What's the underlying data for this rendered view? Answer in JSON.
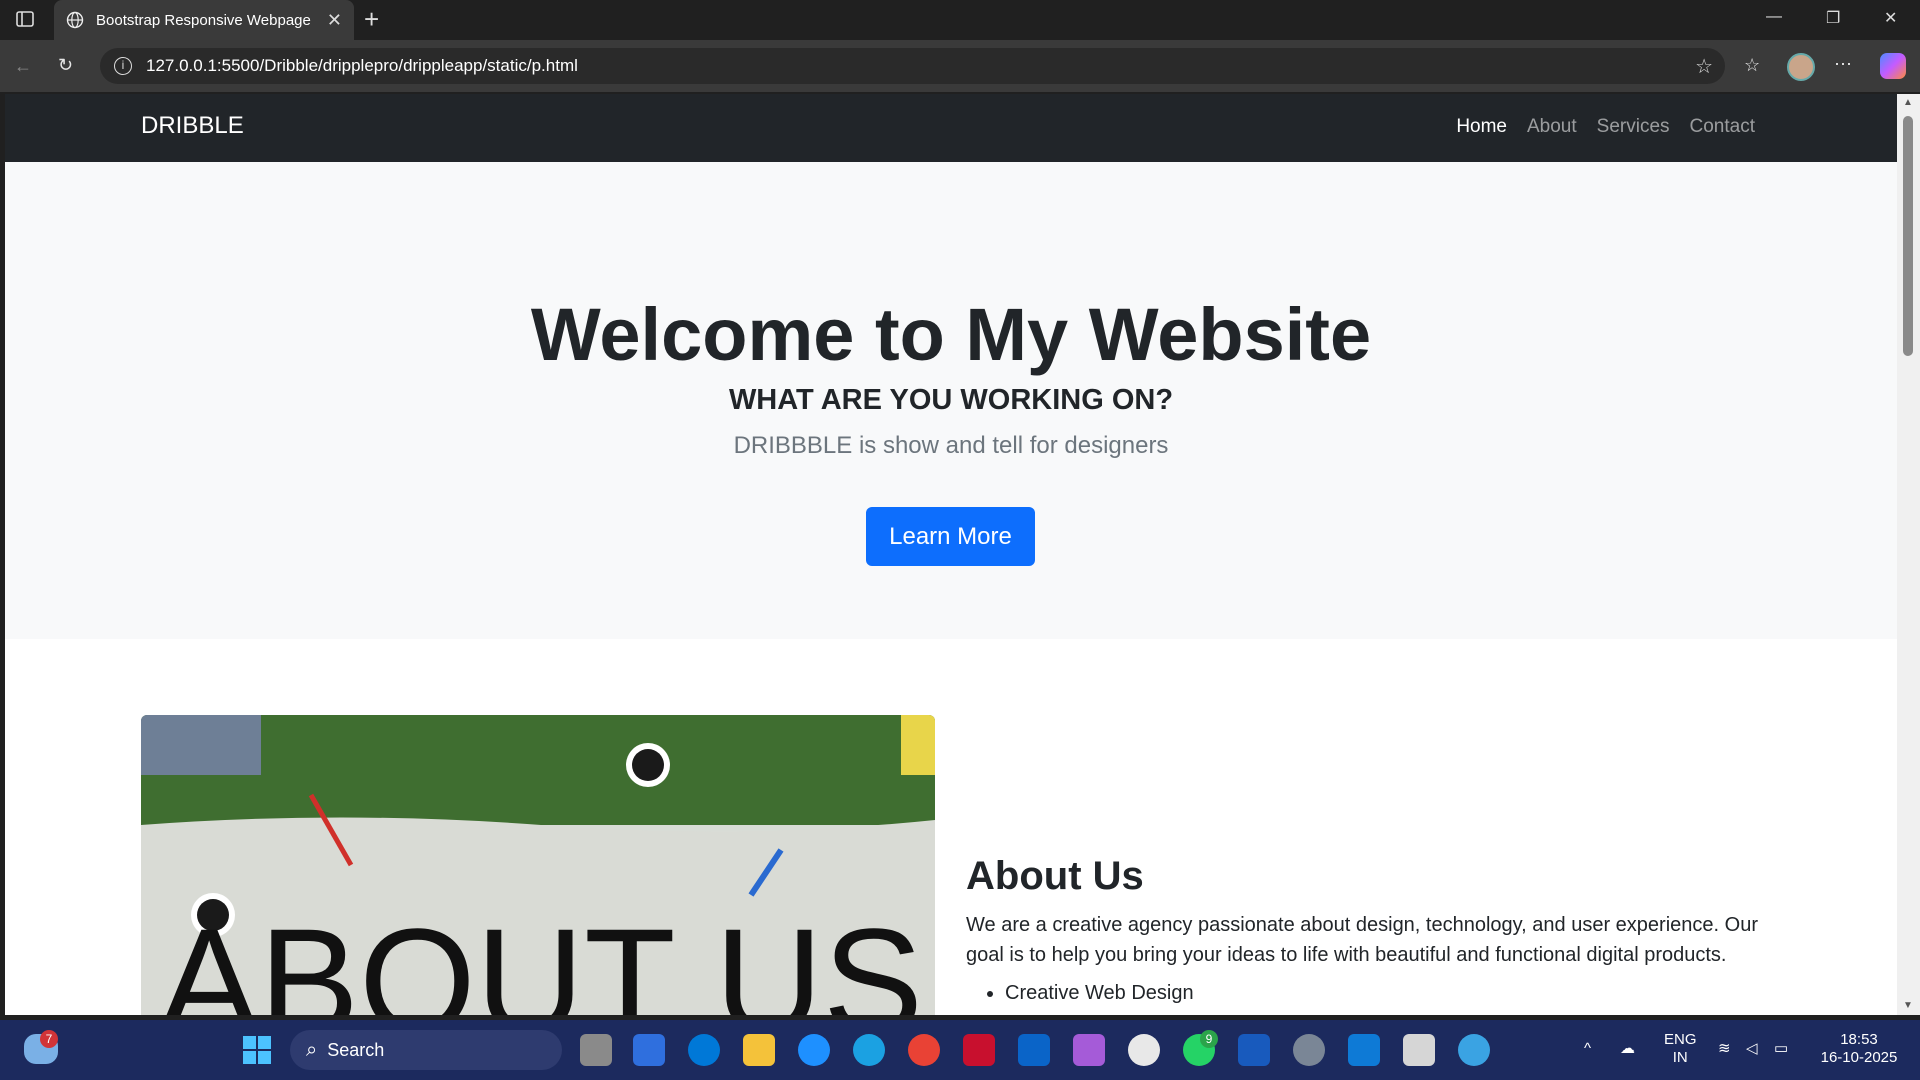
{
  "browser": {
    "tab_title": "Bootstrap Responsive Webpage",
    "address": "127.0.0.1:5500/Dribble/dripplepro/drippleapp/static/p.html"
  },
  "site": {
    "brand": "DRIBBLE",
    "nav": [
      "Home",
      "About",
      "Services",
      "Contact"
    ],
    "active_nav": "Home"
  },
  "hero": {
    "title": "Welcome to My Website",
    "subtitle": "WHAT ARE YOU WORKING ON?",
    "lead": "DRIBBBLE is show and tell for designers",
    "button": "Learn More"
  },
  "about": {
    "image_text": "ABOUT US",
    "heading": "About Us",
    "text": "We are a creative agency passionate about design, technology, and user experience. Our goal is to help you bring your ideas to life with beautiful and functional digital products.",
    "list": [
      "Creative Web Design"
    ]
  },
  "taskbar": {
    "search": "Search",
    "weather_badge": "7",
    "whatsapp_badge": "9",
    "lang_top": "ENG",
    "lang_bottom": "IN",
    "time": "18:53",
    "date": "16-10-2025"
  }
}
